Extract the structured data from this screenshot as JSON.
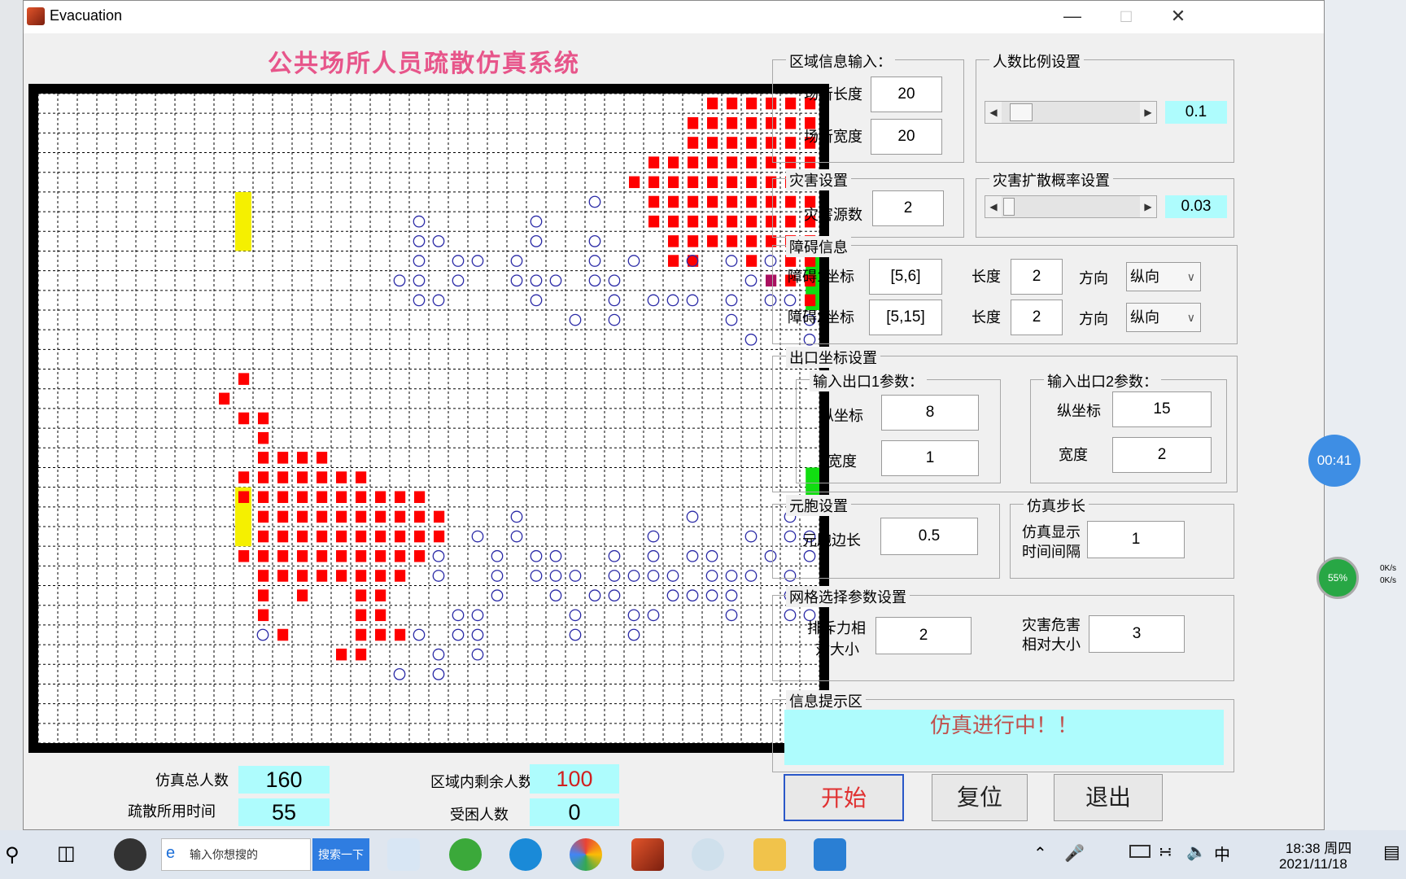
{
  "window": {
    "title": "Evacuation"
  },
  "panel_title": "公共场所人员疏散仿真系统",
  "grid": {
    "cols": 40,
    "rows": 33,
    "exits_right": [
      {
        "row": 8,
        "height": 3
      },
      {
        "row": 19,
        "height": 2
      }
    ],
    "yellow_bars": [
      {
        "col": 10,
        "row": 5,
        "height": 3
      },
      {
        "col": 10,
        "row": 20,
        "height": 3
      }
    ],
    "hazard_cells": [
      [
        34,
        0
      ],
      [
        35,
        0
      ],
      [
        36,
        0
      ],
      [
        37,
        0
      ],
      [
        38,
        0
      ],
      [
        39,
        0
      ],
      [
        33,
        1
      ],
      [
        34,
        1
      ],
      [
        35,
        1
      ],
      [
        36,
        1
      ],
      [
        37,
        1
      ],
      [
        38,
        1
      ],
      [
        39,
        1
      ],
      [
        33,
        2
      ],
      [
        34,
        2
      ],
      [
        35,
        2
      ],
      [
        36,
        2
      ],
      [
        37,
        2
      ],
      [
        38,
        2
      ],
      [
        39,
        2
      ],
      [
        31,
        3
      ],
      [
        32,
        3
      ],
      [
        33,
        3
      ],
      [
        34,
        3
      ],
      [
        35,
        3
      ],
      [
        36,
        3
      ],
      [
        37,
        3
      ],
      [
        38,
        3
      ],
      [
        39,
        3
      ],
      [
        30,
        4
      ],
      [
        31,
        4
      ],
      [
        32,
        4
      ],
      [
        33,
        4
      ],
      [
        34,
        4
      ],
      [
        35,
        4
      ],
      [
        36,
        4
      ],
      [
        37,
        4
      ],
      [
        38,
        4
      ],
      [
        39,
        4
      ],
      [
        31,
        5
      ],
      [
        32,
        5
      ],
      [
        33,
        5
      ],
      [
        34,
        5
      ],
      [
        35,
        5
      ],
      [
        36,
        5
      ],
      [
        37,
        5
      ],
      [
        38,
        5
      ],
      [
        39,
        5
      ],
      [
        31,
        6
      ],
      [
        32,
        6
      ],
      [
        33,
        6
      ],
      [
        34,
        6
      ],
      [
        35,
        6
      ],
      [
        36,
        6
      ],
      [
        37,
        6
      ],
      [
        38,
        6
      ],
      [
        39,
        6
      ],
      [
        32,
        7
      ],
      [
        33,
        7
      ],
      [
        34,
        7
      ],
      [
        35,
        7
      ],
      [
        36,
        7
      ],
      [
        37,
        7
      ],
      [
        38,
        7
      ],
      [
        39,
        7
      ],
      [
        32,
        8
      ],
      [
        33,
        8
      ],
      [
        36,
        8
      ],
      [
        38,
        8
      ],
      [
        39,
        8
      ],
      [
        38,
        9
      ],
      [
        39,
        9
      ],
      [
        39,
        10
      ],
      [
        10,
        14
      ],
      [
        9,
        15
      ],
      [
        10,
        16
      ],
      [
        11,
        16
      ],
      [
        11,
        17
      ],
      [
        11,
        18
      ],
      [
        12,
        18
      ],
      [
        13,
        18
      ],
      [
        14,
        18
      ],
      [
        10,
        19
      ],
      [
        11,
        19
      ],
      [
        12,
        19
      ],
      [
        13,
        19
      ],
      [
        14,
        19
      ],
      [
        15,
        19
      ],
      [
        16,
        19
      ],
      [
        10,
        20
      ],
      [
        11,
        20
      ],
      [
        12,
        20
      ],
      [
        13,
        20
      ],
      [
        14,
        20
      ],
      [
        15,
        20
      ],
      [
        16,
        20
      ],
      [
        17,
        20
      ],
      [
        18,
        20
      ],
      [
        19,
        20
      ],
      [
        11,
        21
      ],
      [
        12,
        21
      ],
      [
        13,
        21
      ],
      [
        14,
        21
      ],
      [
        15,
        21
      ],
      [
        16,
        21
      ],
      [
        17,
        21
      ],
      [
        18,
        21
      ],
      [
        19,
        21
      ],
      [
        20,
        21
      ],
      [
        11,
        22
      ],
      [
        12,
        22
      ],
      [
        13,
        22
      ],
      [
        14,
        22
      ],
      [
        15,
        22
      ],
      [
        16,
        22
      ],
      [
        17,
        22
      ],
      [
        18,
        22
      ],
      [
        19,
        22
      ],
      [
        20,
        22
      ],
      [
        10,
        23
      ],
      [
        11,
        23
      ],
      [
        12,
        23
      ],
      [
        13,
        23
      ],
      [
        14,
        23
      ],
      [
        15,
        23
      ],
      [
        16,
        23
      ],
      [
        17,
        23
      ],
      [
        18,
        23
      ],
      [
        19,
        23
      ],
      [
        11,
        24
      ],
      [
        12,
        24
      ],
      [
        13,
        24
      ],
      [
        14,
        24
      ],
      [
        15,
        24
      ],
      [
        16,
        24
      ],
      [
        17,
        24
      ],
      [
        18,
        24
      ],
      [
        11,
        25
      ],
      [
        13,
        25
      ],
      [
        16,
        25
      ],
      [
        17,
        25
      ],
      [
        11,
        26
      ],
      [
        16,
        26
      ],
      [
        17,
        26
      ],
      [
        12,
        27
      ],
      [
        16,
        27
      ],
      [
        17,
        27
      ],
      [
        18,
        27
      ],
      [
        15,
        28
      ],
      [
        16,
        28
      ]
    ],
    "people_cells": [
      [
        28,
        5
      ],
      [
        19,
        6
      ],
      [
        25,
        6
      ],
      [
        19,
        7
      ],
      [
        20,
        7
      ],
      [
        25,
        7
      ],
      [
        28,
        7
      ],
      [
        19,
        8
      ],
      [
        21,
        8
      ],
      [
        22,
        8
      ],
      [
        24,
        8
      ],
      [
        28,
        8
      ],
      [
        30,
        8
      ],
      [
        33,
        8
      ],
      [
        35,
        8
      ],
      [
        37,
        8
      ],
      [
        18,
        9
      ],
      [
        19,
        9
      ],
      [
        21,
        9
      ],
      [
        24,
        9
      ],
      [
        25,
        9
      ],
      [
        26,
        9
      ],
      [
        28,
        9
      ],
      [
        29,
        9
      ],
      [
        36,
        9
      ],
      [
        19,
        10
      ],
      [
        20,
        10
      ],
      [
        25,
        10
      ],
      [
        29,
        10
      ],
      [
        31,
        10
      ],
      [
        32,
        10
      ],
      [
        33,
        10
      ],
      [
        35,
        10
      ],
      [
        37,
        10
      ],
      [
        38,
        10
      ],
      [
        27,
        11
      ],
      [
        29,
        11
      ],
      [
        35,
        11
      ],
      [
        39,
        11
      ],
      [
        36,
        12
      ],
      [
        39,
        12
      ],
      [
        24,
        21
      ],
      [
        33,
        21
      ],
      [
        38,
        21
      ],
      [
        22,
        22
      ],
      [
        24,
        22
      ],
      [
        31,
        22
      ],
      [
        36,
        22
      ],
      [
        38,
        22
      ],
      [
        39,
        22
      ],
      [
        20,
        23
      ],
      [
        23,
        23
      ],
      [
        25,
        23
      ],
      [
        26,
        23
      ],
      [
        29,
        23
      ],
      [
        31,
        23
      ],
      [
        33,
        23
      ],
      [
        34,
        23
      ],
      [
        37,
        23
      ],
      [
        39,
        23
      ],
      [
        20,
        24
      ],
      [
        23,
        24
      ],
      [
        25,
        24
      ],
      [
        26,
        24
      ],
      [
        27,
        24
      ],
      [
        29,
        24
      ],
      [
        30,
        24
      ],
      [
        31,
        24
      ],
      [
        32,
        24
      ],
      [
        34,
        24
      ],
      [
        35,
        24
      ],
      [
        36,
        24
      ],
      [
        38,
        24
      ],
      [
        23,
        25
      ],
      [
        26,
        25
      ],
      [
        28,
        25
      ],
      [
        29,
        25
      ],
      [
        32,
        25
      ],
      [
        33,
        25
      ],
      [
        34,
        25
      ],
      [
        35,
        25
      ],
      [
        38,
        25
      ],
      [
        39,
        25
      ],
      [
        21,
        26
      ],
      [
        22,
        26
      ],
      [
        27,
        26
      ],
      [
        30,
        26
      ],
      [
        31,
        26
      ],
      [
        35,
        26
      ],
      [
        38,
        26
      ],
      [
        39,
        26
      ],
      [
        11,
        27
      ],
      [
        19,
        27
      ],
      [
        21,
        27
      ],
      [
        22,
        27
      ],
      [
        27,
        27
      ],
      [
        30,
        27
      ],
      [
        20,
        28
      ],
      [
        22,
        28
      ],
      [
        18,
        29
      ],
      [
        20,
        29
      ]
    ],
    "highlight_cell": [
      37,
      9
    ]
  },
  "area_info": {
    "legend": "区域信息输入：",
    "length_label": "场所长度",
    "length_value": "20",
    "width_label": "场所宽度",
    "width_value": "20"
  },
  "people_ratio": {
    "legend": "人数比例设置",
    "value": "0.1"
  },
  "hazard": {
    "legend": "灾害设置",
    "sources_label": "灾害源数",
    "sources_value": "2"
  },
  "spread": {
    "legend": "灾害扩散概率设置",
    "value": "0.03"
  },
  "obstacles": {
    "legend": "障碍信息",
    "rows": [
      {
        "coord_label": "障碍1坐标",
        "coord": "[5,6]",
        "len_label": "长度",
        "len": "2",
        "dir_label": "方向",
        "dir": "纵向"
      },
      {
        "coord_label": "障碍2坐标",
        "coord": "[5,15]",
        "len_label": "长度",
        "len": "2",
        "dir_label": "方向",
        "dir": "纵向"
      }
    ]
  },
  "exits": {
    "legend": "出口坐标设置",
    "exit1": {
      "legend": "输入出口1参数：",
      "y_label": "纵坐标",
      "y": "8",
      "w_label": "宽度",
      "w": "1"
    },
    "exit2": {
      "legend": "输入出口2参数：",
      "y_label": "纵坐标",
      "y": "15",
      "w_label": "宽度",
      "w": "2"
    }
  },
  "cell": {
    "legend": "元胞设置",
    "label": "元胞边长",
    "value": "0.5"
  },
  "step": {
    "legend": "仿真步长",
    "label1": "仿真显示",
    "label2": "时间间隔",
    "value": "1"
  },
  "grid_params": {
    "legend": "网格选择参数设置",
    "rep_l1": "排斥力相",
    "rep_l2": "对大小",
    "rep_value": "2",
    "haz_l1": "灾害危害",
    "haz_l2": "相对大小",
    "haz_value": "3"
  },
  "info": {
    "legend": "信息提示区",
    "message": "仿真进行中！！"
  },
  "buttons": {
    "start": "开始",
    "reset": "复位",
    "exit": "退出"
  },
  "stats": {
    "total_label": "仿真总人数",
    "total": "160",
    "time_label": "疏散所用时间",
    "time": "55",
    "remain_label": "区域内剩余人数",
    "remain": "100",
    "trapped_label": "受困人数",
    "trapped": "0"
  },
  "overlay": {
    "timer": "00:41",
    "cpu": "55%",
    "up": "0K/s",
    "down": "0K/s"
  },
  "taskbar": {
    "search_placeholder": "输入你想搜的",
    "search_button": "搜索一下",
    "time": "18:38 周四",
    "date": "2021/11/18",
    "ime": "中"
  },
  "colors": {
    "hazard": "#ff0000",
    "person": "#2a2aa6",
    "exit": "#11dd11",
    "obstacle": "#f5f000",
    "highlight": "#aa1060"
  }
}
